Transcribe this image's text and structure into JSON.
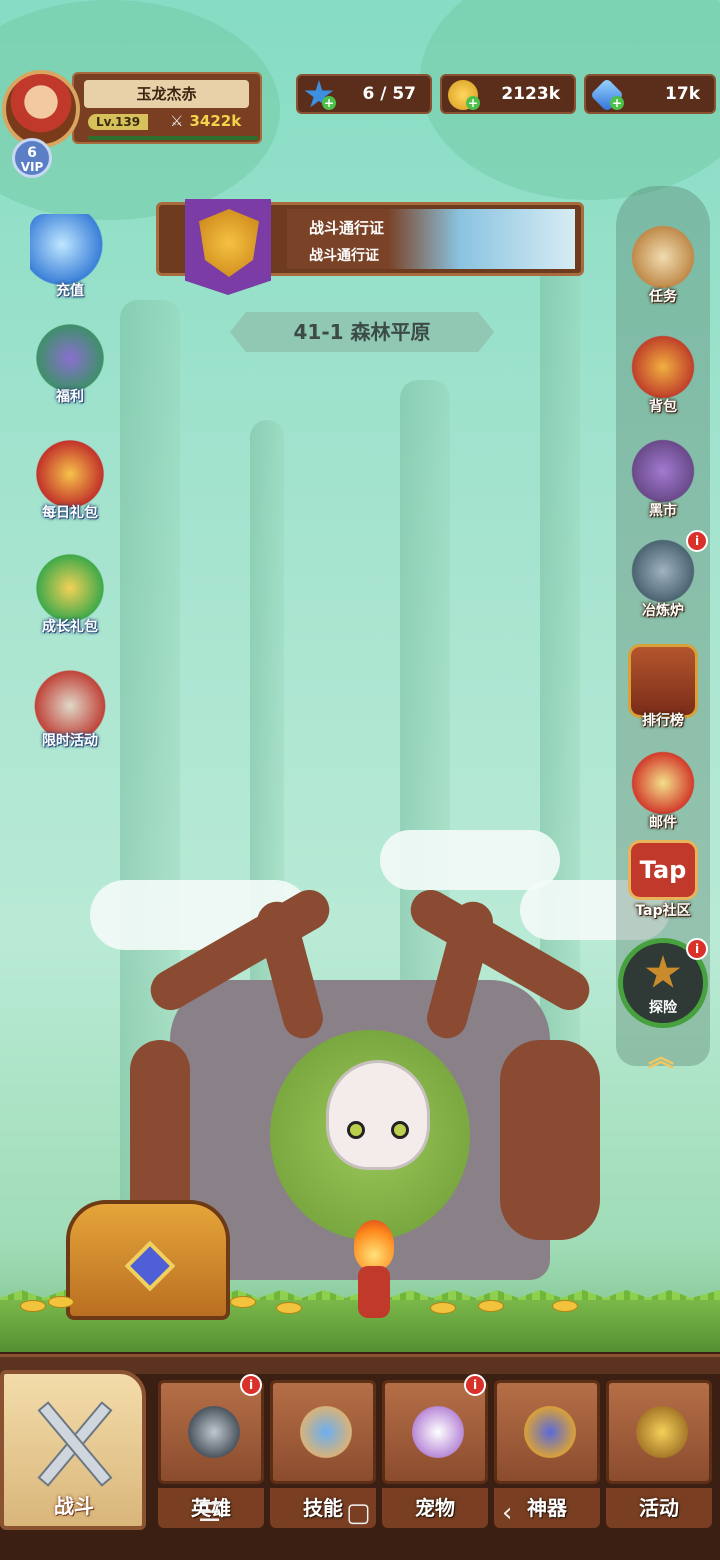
{
  "player": {
    "name": "玉龙杰赤",
    "level": "Lv.139",
    "power": "3422k",
    "vip_label": "VIP",
    "vip_level": "6"
  },
  "resources": {
    "stamina": "6 / 57",
    "gold": "2123k",
    "gems": "17k"
  },
  "battle_pass": {
    "title": "战斗通行证",
    "subtitle": "战斗通行证"
  },
  "stage": "41-1 森林平原",
  "left_menu": [
    {
      "label": "充值",
      "icon": "gem-pile-icon"
    },
    {
      "label": "福利",
      "icon": "wizard-gift-icon"
    },
    {
      "label": "每日礼包",
      "icon": "daily-gift-box-icon"
    },
    {
      "label": "成长礼包",
      "icon": "growth-gift-box-icon"
    },
    {
      "label": "限时活动",
      "icon": "money-bag-icon"
    }
  ],
  "right_menu": [
    {
      "label": "任务",
      "icon": "scroll-quill-icon"
    },
    {
      "label": "背包",
      "icon": "backpack-icon"
    },
    {
      "label": "黑市",
      "icon": "market-stall-icon"
    },
    {
      "label": "冶炼炉",
      "icon": "anvil-icon"
    },
    {
      "label": "排行榜",
      "icon": "trophy-icon"
    },
    {
      "label": "邮件",
      "icon": "mail-icon"
    },
    {
      "label": "Tap社区",
      "icon": "tap-logo-icon",
      "logo_text": "Tap"
    }
  ],
  "explore": {
    "label": "探险"
  },
  "badge": "i",
  "bottom_nav": {
    "battle": "战斗",
    "tabs": [
      {
        "label": "英雄",
        "icon": "knight-helmet-icon",
        "badge": true
      },
      {
        "label": "技能",
        "icon": "spellbook-icon",
        "badge": false
      },
      {
        "label": "宠物",
        "icon": "winged-pet-icon",
        "badge": true
      },
      {
        "label": "神器",
        "icon": "artifact-emblem-icon",
        "badge": false
      },
      {
        "label": "活动",
        "icon": "horn-icon",
        "badge": false
      }
    ]
  },
  "colors": {
    "accent_gold": "#f2d34a",
    "badge_red": "#d9302a",
    "panel_brown": "#7a3f22"
  }
}
